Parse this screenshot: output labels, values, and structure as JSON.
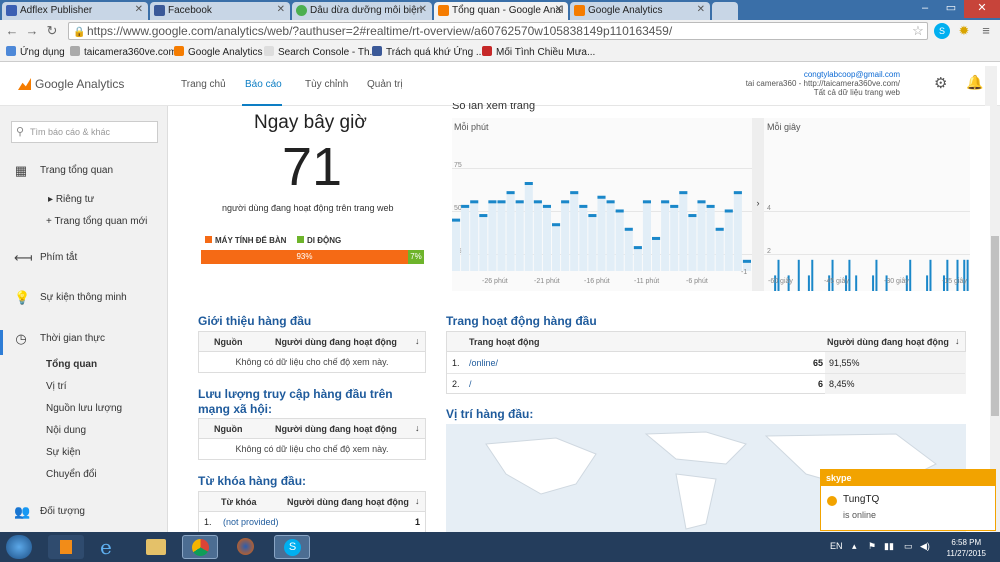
{
  "browser": {
    "tabs": [
      {
        "title": "Adflex Publisher",
        "color": "#3b5fb3"
      },
      {
        "title": "Facebook",
        "color": "#3b5998"
      },
      {
        "title": "Dâu dừa dưỡng môi biện",
        "color": "#4caf50"
      },
      {
        "title": "Tổng quan - Google Anal",
        "color": "#f57c00"
      },
      {
        "title": "Google Analytics",
        "color": "#f57c00"
      }
    ],
    "url": "https://www.google.com/analytics/web/?authuser=2#realtime/rt-overview/a60762570w105838149p110163459/",
    "bookmarks": [
      "Ứng dụng",
      "taicamera360ve.com",
      "Google Analytics",
      "Search Console - Th...",
      "Trách quá khứ Ứng ...",
      "Mối Tình Chiều Mưa..."
    ]
  },
  "ga": {
    "logo": "Google Analytics",
    "nav": [
      "Trang chủ",
      "Báo cáo",
      "Tùy chỉnh",
      "Quản trị"
    ],
    "account_email": "congtylabcoop@gmail.com",
    "account_site": "tai camera360 - http://taicamera360ve.com/",
    "account_view": "Tất cả dữ liệu trang web"
  },
  "sidebar": {
    "search_placeholder": "Tìm báo cáo & khác",
    "items": {
      "overview": "Trang tổng quan",
      "private": "Riêng tư",
      "new_dashboard": "+ Trang tổng quan mới",
      "shortcuts": "Phím tắt",
      "intelligence": "Sự kiện thông minh",
      "realtime": "Thời gian thực",
      "rt_overview": "Tổng quan",
      "rt_location": "Vị trí",
      "rt_traffic": "Nguồn lưu lượng",
      "rt_content": "Nội dung",
      "rt_events": "Sự kiện",
      "rt_conversions": "Chuyển đổi",
      "audience": "Đối tượng"
    }
  },
  "realtime": {
    "now_label": "Ngay bây giờ",
    "active_users": "71",
    "subtitle": "người dùng đang hoạt động trên trang web",
    "legend_desktop": "MÁY TÍNH ĐỂ BÀN",
    "legend_mobile": "DI ĐỘNG",
    "desktop_pct": 93,
    "mobile_pct": 7,
    "desktop_label": "93%",
    "mobile_label": "7%",
    "desktop_color": "#f56a15",
    "mobile_color": "#6eb42b"
  },
  "pageviews": {
    "title": "Số lần xem trang",
    "per_minute": "Mỗi phút",
    "per_second": "Mỗi giây",
    "minute_ticks": [
      "75",
      "50",
      "25"
    ],
    "minute_x": [
      "-26 phút",
      "-21 phút",
      "-16 phút",
      "-11 phút",
      "-6 phút",
      "-1"
    ],
    "second_ticks": [
      "4",
      "2"
    ],
    "second_x": [
      "-60 giây",
      "-45 giây",
      "-30 giây",
      "-15 giây"
    ]
  },
  "chart_data": [
    {
      "type": "bar",
      "title": "Mỗi phút",
      "ylim": [
        0,
        75
      ],
      "values": [
        22,
        28,
        30,
        24,
        30,
        30,
        34,
        30,
        38,
        30,
        28,
        20,
        30,
        34,
        28,
        24,
        32,
        30,
        26,
        18,
        10,
        30,
        14,
        30,
        28,
        34,
        24,
        30,
        28,
        18,
        26,
        34,
        4
      ]
    },
    {
      "type": "bar",
      "title": "Mỗi giây",
      "ylim": [
        0,
        5
      ],
      "values": [
        0,
        0,
        0,
        1,
        2,
        0,
        0,
        1,
        0,
        0,
        2,
        0,
        0,
        1,
        2,
        0,
        0,
        0,
        0,
        1,
        2,
        0,
        0,
        0,
        1,
        2,
        0,
        1,
        0,
        0,
        0,
        0,
        1,
        2,
        0,
        0,
        1,
        0,
        0,
        0,
        0,
        0,
        1,
        2,
        0,
        0,
        0,
        0,
        1,
        2,
        0,
        0,
        0,
        1,
        2,
        0,
        0,
        2,
        0,
        2,
        2
      ]
    }
  ],
  "referrals": {
    "title": "Giới thiệu hàng đầu",
    "col_source": "Nguồn",
    "col_users": "Người dùng đang hoạt động",
    "empty": "Không có dữ liệu cho chế độ xem này."
  },
  "social": {
    "title_line1": "Lưu lượng truy cập hàng đầu trên",
    "title_line2": "mạng xã hội:",
    "col_source": "Nguồn",
    "col_users": "Người dùng đang hoạt động",
    "empty": "Không có dữ liệu cho chế độ xem này."
  },
  "keywords": {
    "title": "Từ khóa hàng đầu:",
    "col_keyword": "Từ khóa",
    "col_users": "Người dùng đang hoạt động",
    "rows": [
      {
        "idx": "1.",
        "keyword": "(not provided)",
        "users": "1"
      }
    ]
  },
  "active_pages": {
    "title": "Trang hoạt động hàng đầu",
    "col_page": "Trang hoạt động",
    "col_users": "Người dùng đang hoạt động",
    "rows": [
      {
        "idx": "1.",
        "page": "/online/",
        "users": "65",
        "pct": "91,55%"
      },
      {
        "idx": "2.",
        "page": "/",
        "users": "6",
        "pct": "8,45%"
      }
    ]
  },
  "locations": {
    "title": "Vị trí hàng đầu:"
  },
  "skype": {
    "brand": "skype",
    "name": "TungTQ",
    "status": "is online"
  },
  "taskbar": {
    "lang": "EN",
    "time": "6:58 PM",
    "date": "11/27/2015"
  }
}
